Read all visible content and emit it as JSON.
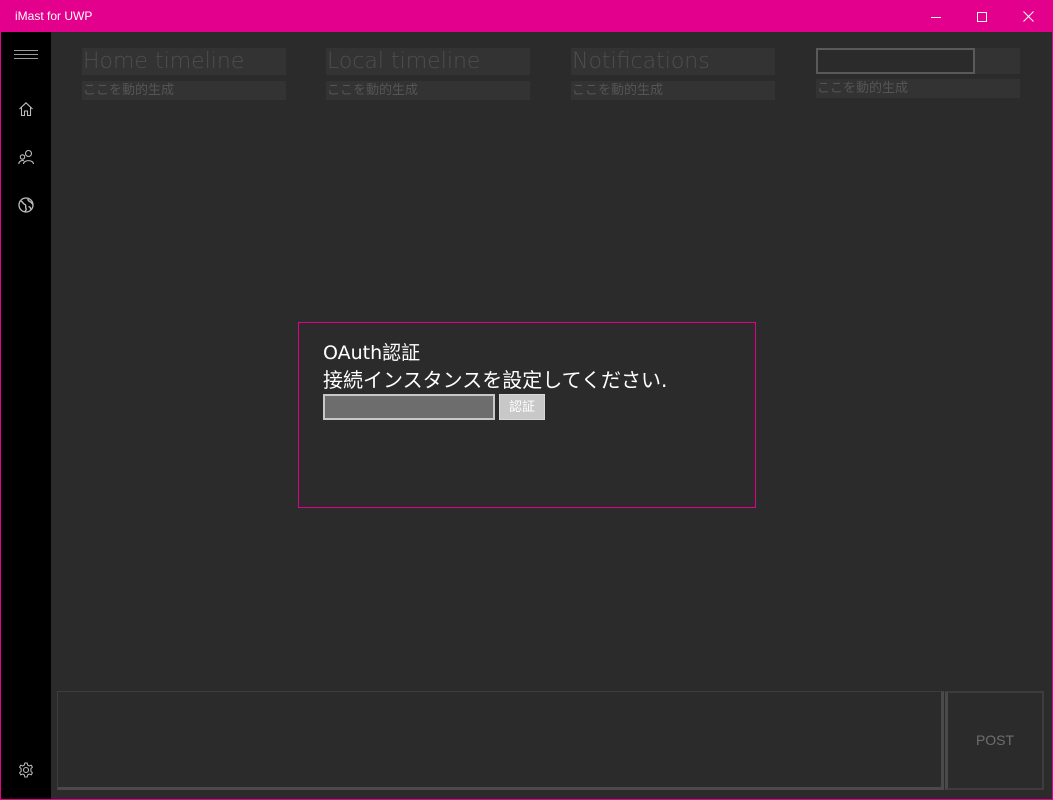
{
  "window": {
    "title": "iMast for UWP",
    "accent_color": "#e3008c"
  },
  "nav": {
    "items": [
      {
        "icon": "hamburger-menu-icon"
      },
      {
        "icon": "home-icon"
      },
      {
        "icon": "people-icon"
      },
      {
        "icon": "globe-icon"
      },
      {
        "icon": "gear-icon"
      }
    ]
  },
  "columns": [
    {
      "title": "Home timeline",
      "subtitle": "ここを動的生成"
    },
    {
      "title": "Local timeline",
      "subtitle": "ここを動的生成"
    },
    {
      "title": "Notifications",
      "subtitle": "ここを動的生成"
    },
    {
      "title": "",
      "subtitle": "ここを動的生成"
    }
  ],
  "dialog": {
    "title": "OAuth認証",
    "message": "接続インスタンスを設定してください.",
    "input_value": "",
    "button_label": "認証"
  },
  "compose": {
    "value": "",
    "post_label": "POST"
  }
}
